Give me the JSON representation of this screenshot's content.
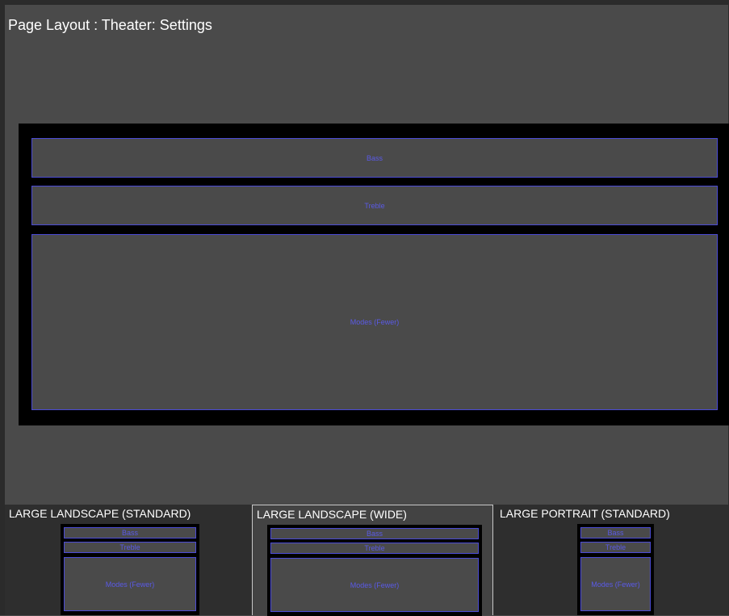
{
  "page": {
    "title": "Page Layout : Theater: Settings"
  },
  "preview": {
    "blocks": {
      "bass": "Bass",
      "treble": "Treble",
      "modes": "Modes (Fewer)"
    }
  },
  "layouts": [
    {
      "label": "LARGE LANDSCAPE (STANDARD)",
      "selected": false,
      "blocks": {
        "bass": "Bass",
        "treble": "Treble",
        "modes": "Modes (Fewer)"
      }
    },
    {
      "label": "LARGE LANDSCAPE (WIDE)",
      "selected": true,
      "blocks": {
        "bass": "Bass",
        "treble": "Treble",
        "modes": "Modes (Fewer)"
      }
    },
    {
      "label": "LARGE PORTRAIT (STANDARD)",
      "selected": false,
      "blocks": {
        "bass": "Bass",
        "treble": "Treble",
        "modes": "Modes (Fewer)"
      }
    }
  ],
  "colors": {
    "background": "#4a4a4a",
    "canvas": "#000000",
    "block_border": "#4b4bd6",
    "block_text": "#5a5ae6",
    "tray": "#2e2e2e",
    "selected_outline": "#c8c8c8"
  }
}
